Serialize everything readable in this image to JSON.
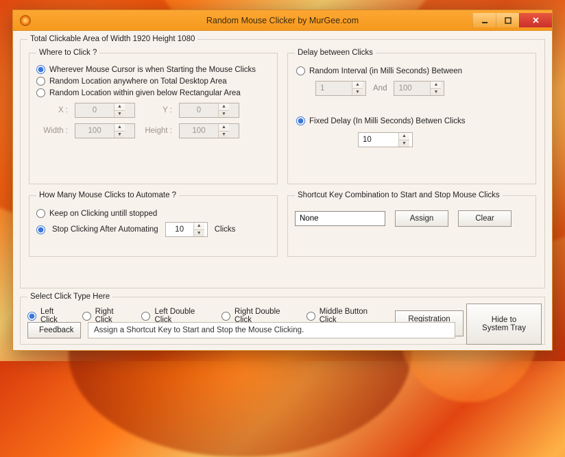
{
  "window": {
    "title": "Random Mouse Clicker by MurGee.com"
  },
  "outer": {
    "legend": "Total Clickable Area of Width 1920 Height 1080"
  },
  "where": {
    "legend": "Where to Click ?",
    "opt_cursor": "Wherever Mouse Cursor is when Starting the Mouse Clicks",
    "opt_desktop": "Random Location anywhere on Total Desktop Area",
    "opt_rect": "Random Location within given below Rectangular Area",
    "selected": "cursor",
    "x_label": "X :",
    "x_value": "0",
    "y_label": "Y :",
    "y_value": "0",
    "w_label": "Width :",
    "w_value": "100",
    "h_label": "Height :",
    "h_value": "100"
  },
  "delay": {
    "legend": "Delay between Clicks",
    "opt_random": "Random Interval (in Milli Seconds) Between",
    "rand_from": "1",
    "rand_and": "And",
    "rand_to": "100",
    "opt_fixed": "Fixed Delay (In Milli Seconds) Betwen Clicks",
    "fixed_value": "10",
    "selected": "fixed"
  },
  "howmany": {
    "legend": "How Many Mouse Clicks to Automate ?",
    "opt_keep": "Keep on Clicking untill stopped",
    "opt_stop": "Stop Clicking After Automating",
    "stop_value": "10",
    "stop_suffix": "Clicks",
    "selected": "stop"
  },
  "shortcut": {
    "legend": "Shortcut Key Combination to Start and Stop Mouse Clicks",
    "value": "None",
    "assign": "Assign",
    "clear": "Clear"
  },
  "clicktype": {
    "legend": "Select Click Type Here",
    "left": "Left Click",
    "right": "Right Click",
    "left_dbl": "Left Double Click",
    "right_dbl": "Right Double Click",
    "middle": "Middle Button Click",
    "selected": "left"
  },
  "buttons": {
    "registration": "Registration Key",
    "hide_tray": "Hide to System Tray",
    "feedback": "Feedback"
  },
  "status": "Assign a Shortcut Key to Start and Stop the Mouse Clicking."
}
